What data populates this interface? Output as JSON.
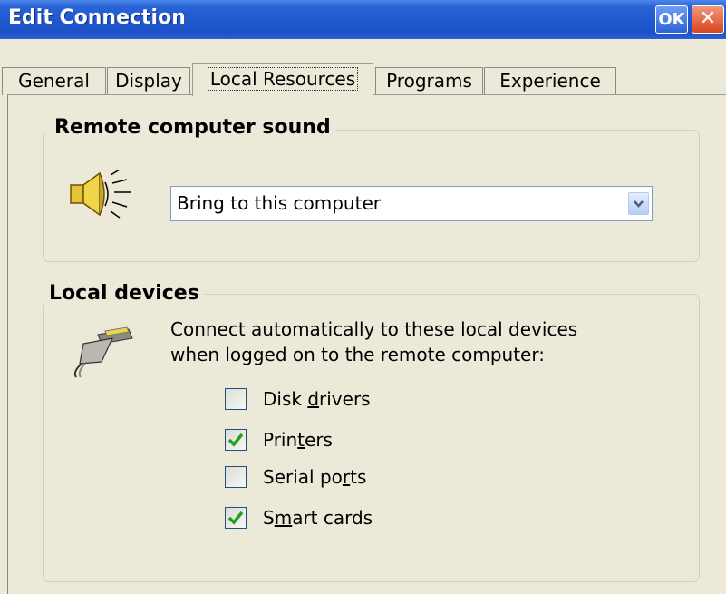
{
  "window": {
    "title": "Edit Connection",
    "ok_label": "OK",
    "close_glyph": "✕"
  },
  "tabs": [
    {
      "label": "General",
      "active": false
    },
    {
      "label": "Display",
      "active": false
    },
    {
      "label": "Local Resources",
      "active": true
    },
    {
      "label": "Programs",
      "active": false
    },
    {
      "label": "Experience",
      "active": false
    }
  ],
  "sound_group": {
    "title": "Remote computer sound",
    "icon": "speaker-icon",
    "selected": "Bring to this computer"
  },
  "devices_group": {
    "title": "Local devices",
    "icon": "cable-plug-icon",
    "description_line1": "Connect automatically to these local devices",
    "description_line2": "when logged on to the remote computer:",
    "items": [
      {
        "before": "Disk ",
        "mnemonic": "d",
        "after": "rivers",
        "checked": false
      },
      {
        "before": "Prin",
        "mnemonic": "t",
        "after": "ers",
        "checked": true
      },
      {
        "before": "Serial po",
        "mnemonic": "r",
        "after": "ts",
        "checked": false
      },
      {
        "before": "S",
        "mnemonic": "m",
        "after": "art cards",
        "checked": true
      }
    ]
  },
  "colors": {
    "title_bar": "#1f57cf",
    "face": "#ece9d8",
    "checkmark": "#21a121",
    "close_button": "#d8451f"
  }
}
